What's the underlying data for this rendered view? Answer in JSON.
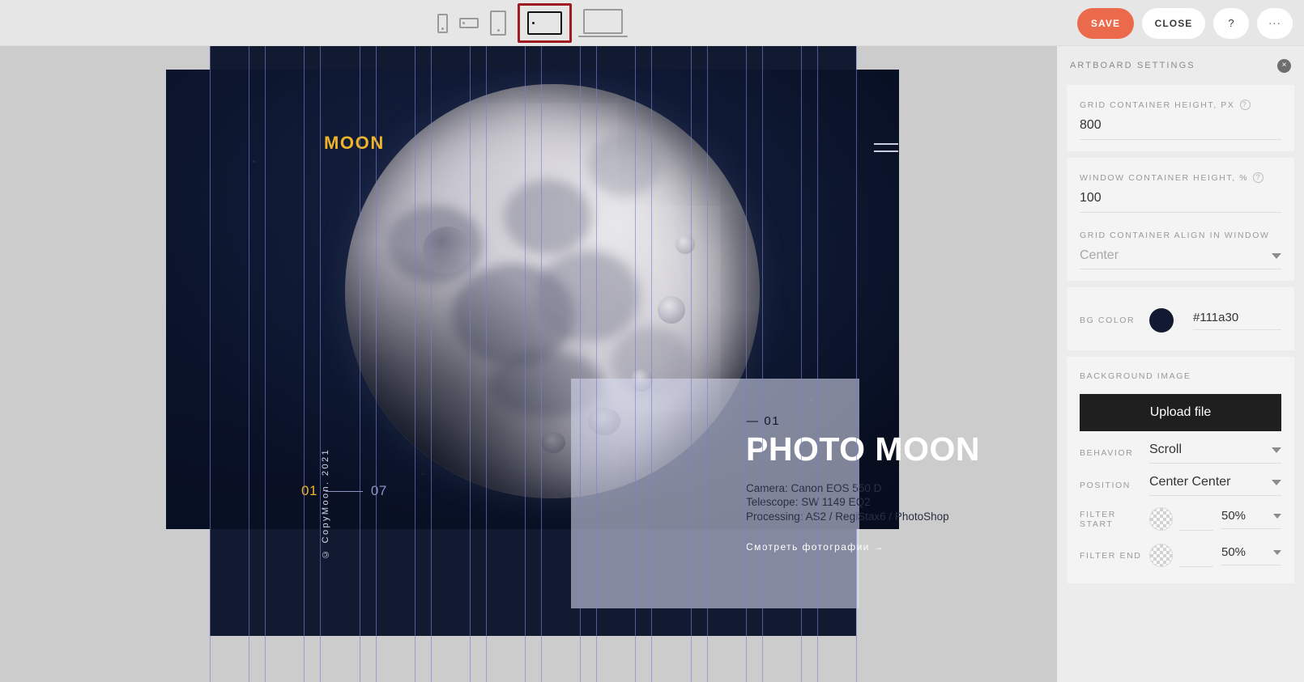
{
  "toolbar": {
    "devices": [
      {
        "name": "phone-portrait",
        "selected": false
      },
      {
        "name": "phone-landscape",
        "selected": false
      },
      {
        "name": "tablet-portrait",
        "selected": false
      },
      {
        "name": "tablet-landscape",
        "selected": true
      },
      {
        "name": "laptop",
        "selected": false
      }
    ],
    "save_label": "SAVE",
    "close_label": "CLOSE",
    "help_label": "?",
    "more_label": "...",
    "accent_color": "#ec6a4c",
    "selected_outline_color": "#9e1b22"
  },
  "artboard": {
    "logo": "MOON",
    "logo_color": "#f0b429",
    "copyright": "© CopyMoon. 2021",
    "pager": {
      "current": "01",
      "total": "07"
    },
    "card": {
      "index": "— 01",
      "title": "PHOTO MOON",
      "specs": [
        "Camera: Canon EOS 550 D",
        "Telescope: SW 1149 EQ2",
        "Processing: AS2 / RegiStax6 / PhotoShop"
      ],
      "cta": "Смотреть фотографии →"
    }
  },
  "settings": {
    "title": "ARTBOARD SETTINGS",
    "close_icon": "×",
    "grid_container_height": {
      "label": "GRID CONTAINER HEIGHT, PX",
      "help": "?",
      "value": "800"
    },
    "window_container_height": {
      "label": "WINDOW CONTAINER HEIGHT, %",
      "help": "?",
      "value": "100"
    },
    "grid_align": {
      "label": "GRID CONTAINER ALIGN IN WINDOW",
      "value": "Center"
    },
    "bg_color": {
      "label": "BG COLOR",
      "value": "#111a30"
    },
    "background_image": {
      "section_label": "BACKGROUND IMAGE",
      "upload_label": "Upload file",
      "behavior": {
        "label": "BEHAVIOR",
        "value": "Scroll"
      },
      "position": {
        "label": "POSITION",
        "value": "Center Center"
      },
      "filter_start": {
        "label": "FILTER START",
        "value": "50%"
      },
      "filter_end": {
        "label": "FILTER END",
        "value": "50%"
      }
    }
  }
}
